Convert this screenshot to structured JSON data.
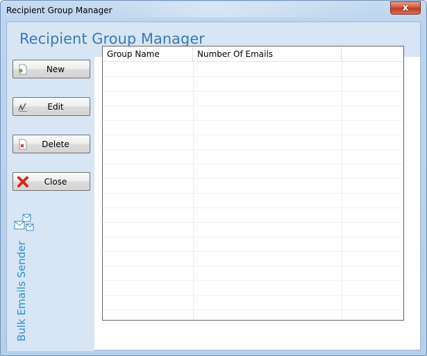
{
  "window": {
    "title": "Recipient Group Manager",
    "close_glyph": "x"
  },
  "header": {
    "title": "Recipient Group Manager"
  },
  "sidebar": {
    "buttons": [
      {
        "label": "New",
        "icon": "new-document-icon"
      },
      {
        "label": "Edit",
        "icon": "edit-pen-icon"
      },
      {
        "label": "Delete",
        "icon": "delete-document-icon"
      },
      {
        "label": "Close",
        "icon": "close-x-icon"
      }
    ],
    "brand": {
      "icon": "envelopes-icon",
      "text": "Bulk Emails Sender"
    }
  },
  "grid": {
    "columns": [
      "Group Name",
      "Number Of Emails",
      ""
    ],
    "rows": []
  },
  "colors": {
    "accent": "#3b79b5",
    "brand_text": "#2a8fce",
    "client_bg": "#d7e5f4",
    "close_button": "#c23a21"
  }
}
